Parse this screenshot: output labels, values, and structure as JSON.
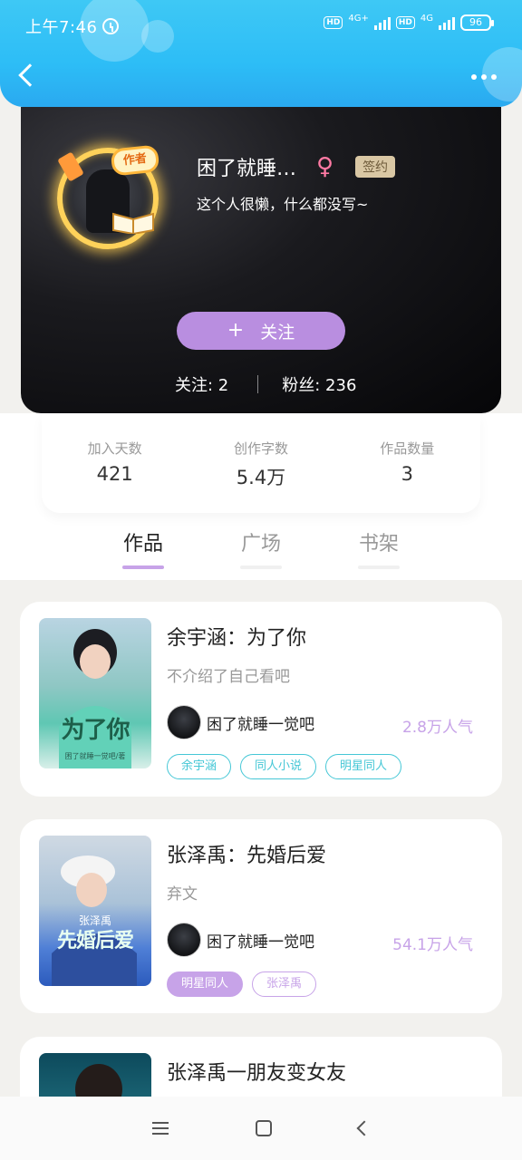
{
  "status_bar": {
    "time": "上午7:46",
    "network_1": "4G+",
    "network_2": "4G",
    "hd_label": "HD",
    "battery": "96"
  },
  "profile": {
    "avatar_badge": "作者",
    "name": "困了就睡…",
    "gender_symbol": "♀",
    "signed_badge": "签约",
    "bio": "这个人很懒，什么都没写~",
    "follow_button": "关注",
    "follow_plus": "+",
    "following_label": "关注: 2",
    "fans_label": "粉丝: 236"
  },
  "stats": [
    {
      "label": "加入天数",
      "value": "421"
    },
    {
      "label": "创作字数",
      "value": "5.4万"
    },
    {
      "label": "作品数量",
      "value": "3"
    }
  ],
  "tabs": [
    {
      "label": "作品",
      "active": true
    },
    {
      "label": "广场",
      "active": false
    },
    {
      "label": "书架",
      "active": false
    }
  ],
  "books": [
    {
      "title": "余宇涵：为了你",
      "desc": "不介绍了自己看吧",
      "author": "困了就睡一觉吧",
      "popularity": "2.8万人气",
      "cover_text": "为了你",
      "cover_sub": "困了就睡一觉吧/著",
      "tags": [
        "余宇涵",
        "同人小说",
        "明星同人"
      ]
    },
    {
      "title": "张泽禹：先婚后爱",
      "desc": "弃文",
      "author": "困了就睡一觉吧",
      "popularity": "54.1万人气",
      "cover_text": "先婚后爱",
      "cover_sub": "张泽禹",
      "tags": [
        "明星同人",
        "张泽禹"
      ]
    },
    {
      "title": "张泽禹一朋友变女友"
    }
  ],
  "colors": {
    "header": "#2dbdf6",
    "accent_purple": "#c7a3e8",
    "tag_cyan": "#45c7d6"
  }
}
